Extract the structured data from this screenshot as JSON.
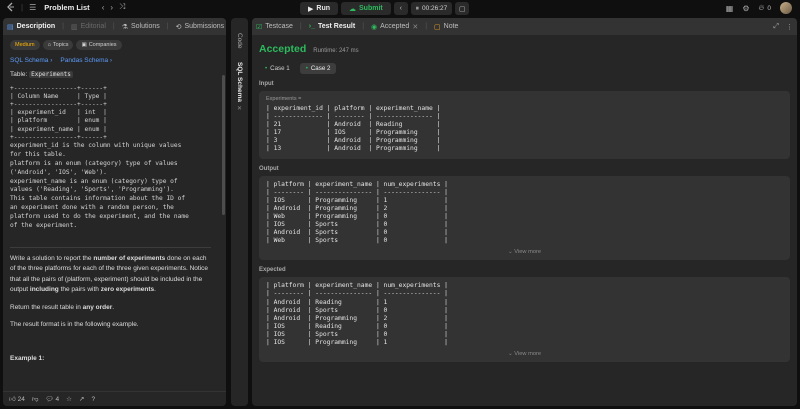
{
  "topbar": {
    "title": "Problem List",
    "run_label": "Run",
    "submit_label": "Submit",
    "timer": "00:26:27",
    "notifications": "0"
  },
  "left_tabs": [
    "Description",
    "Editorial",
    "Solutions",
    "Submissions"
  ],
  "badges": [
    "Medium",
    "Topics",
    "Companies"
  ],
  "links": [
    "SQL Schema",
    "Pandas Schema"
  ],
  "table_label": "Table:",
  "table_name": "Experiments",
  "schema_lines": [
    "+-----------------+------+",
    "| Column Name     | Type |",
    "+-----------------+------+",
    "| experiment_id   | int  |",
    "| platform        | enum |",
    "| experiment_name | enum |",
    "+-----------------+------+"
  ],
  "desc_lines": [
    "experiment_id is the column with unique values",
    "for this table.",
    "platform is an enum (category) type of values",
    "('Android', 'IOS', 'Web').",
    "experiment_name is an enum (category) type of",
    "values ('Reading', 'Sports', 'Programming').",
    "This table contains information about the ID of",
    "an experiment done with a random person, the",
    "platform used to do the experiment, and the name",
    "of the experiment."
  ],
  "task": {
    "p1_a": "Write a solution to report the ",
    "p1_b": "number of experiments",
    "p1_c": " done on each of the three platforms for each of the three given experiments. Notice that all the pairs of (platform, experiment) should be included in the output ",
    "p1_d": "including",
    "p1_e": " the pairs with ",
    "p1_f": "zero experiments",
    "p1_g": ".",
    "p2_a": "Return the result table in ",
    "p2_b": "any order",
    "p2_c": ".",
    "p3": "The result format is in the following example.",
    "example": "Example 1:"
  },
  "left_bottom": {
    "likes": "24",
    "comments": "4"
  },
  "side_tabs": [
    "Code",
    "SQL Schema"
  ],
  "right_tabs": [
    "Testcase",
    "Test Result",
    "Accepted",
    "Note"
  ],
  "result": {
    "status": "Accepted",
    "runtime": "Runtime: 247 ms",
    "cases": [
      "Case 1",
      "Case 2"
    ],
    "input_label": "Input",
    "input_table_label": "Experiments =",
    "input_lines": [
      "| experiment_id | platform | experiment_name |",
      "| ------------- | -------- | --------------- |",
      "| 21            | Android  | Reading         |",
      "| 17            | IOS      | Programming     |",
      "| 3             | Android  | Programming     |",
      "| 13            | Android  | Programming     |"
    ],
    "output_label": "Output",
    "output_lines": [
      "| platform | experiment_name | num_experiments |",
      "| -------- | --------------- | --------------- |",
      "| IOS      | Programming     | 1               |",
      "| Android  | Programming     | 2               |",
      "| Web      | Programming     | 0               |",
      "| IOS      | Sports          | 0               |",
      "| Android  | Sports          | 0               |",
      "| Web      | Sports          | 0               |"
    ],
    "expected_label": "Expected",
    "expected_lines": [
      "| platform | experiment_name | num_experiments |",
      "| -------- | --------------- | --------------- |",
      "| Android  | Reading         | 1               |",
      "| Android  | Sports          | 0               |",
      "| Android  | Programming     | 2               |",
      "| IOS      | Reading         | 0               |",
      "| IOS      | Sports          | 0               |",
      "| IOS      | Programming     | 1               |"
    ],
    "view_more": "View more"
  },
  "colors": {
    "accent_green": "#2cbb5d",
    "medium": "#ffb800",
    "link": "#5b9cf8"
  }
}
